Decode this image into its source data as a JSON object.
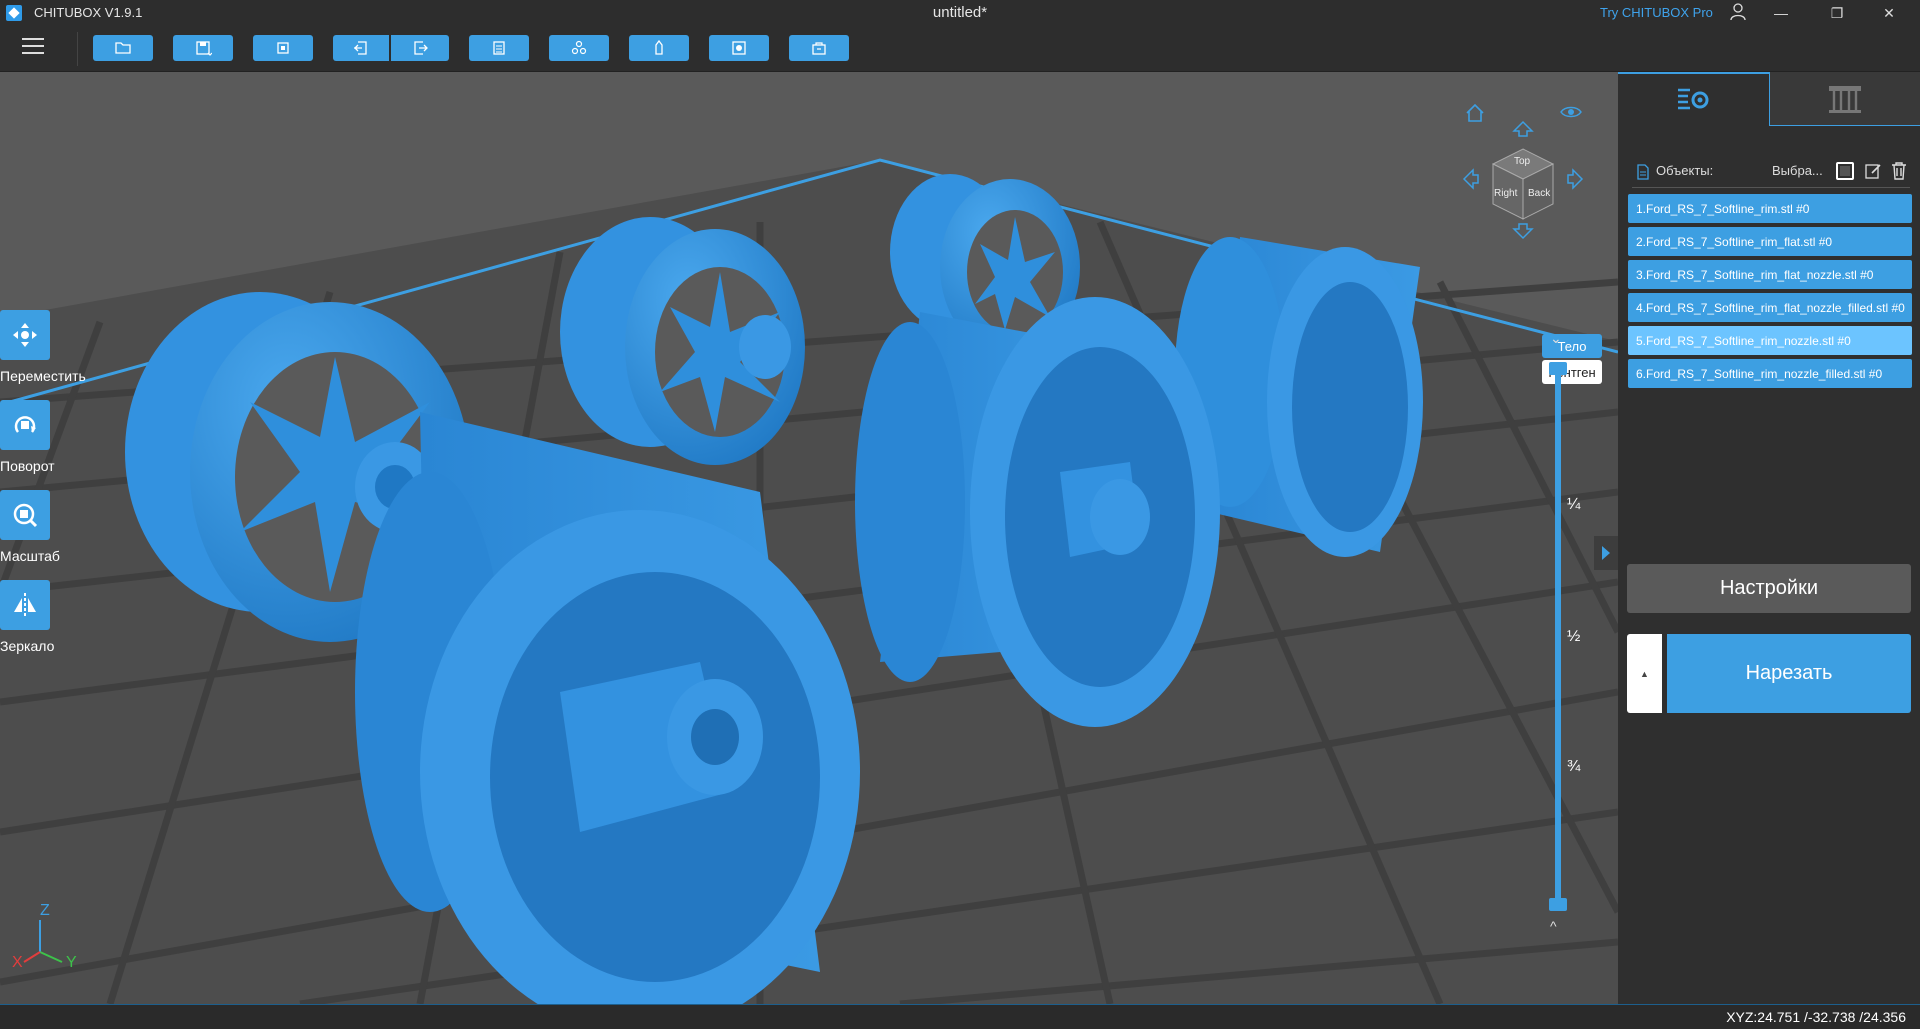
{
  "app": {
    "name": "CHITUBOX V1.9.1",
    "document_title": "untitled*",
    "try_pro": "Try CHITUBOX Pro"
  },
  "window": {
    "minimize": "—",
    "maximize": "❐",
    "close": "✕"
  },
  "toolbar": {
    "buttons": [
      "open-icon",
      "save-icon",
      "frame-icon",
      "import-icon",
      "export-icon",
      "layers-icon",
      "arrange-icon",
      "support-icon",
      "hollow-icon",
      "package-icon"
    ]
  },
  "tools": [
    {
      "id": "move",
      "label": "Переместить"
    },
    {
      "id": "rotate",
      "label": "Поворот"
    },
    {
      "id": "scale",
      "label": "Масштаб"
    },
    {
      "id": "mirror",
      "label": "Зеркало"
    }
  ],
  "nav_cube": {
    "top": "Top",
    "right": "Right",
    "back": "Back"
  },
  "view_modes": {
    "solid": "Тело",
    "xray": "Рентген",
    "active": "solid"
  },
  "layer_slider": {
    "marks": [
      "¼",
      "½",
      "¾"
    ],
    "upper_handle": 1.0,
    "lower_handle": 0.0
  },
  "axis": {
    "z": "Z",
    "x": "X",
    "y": "Y"
  },
  "panel": {
    "objects_label": "Объекты:",
    "select_label": "Выбра...",
    "objects": [
      "1.Ford_RS_7_Softline_rim.stl #0",
      "2.Ford_RS_7_Softline_rim_flat.stl #0",
      "3.Ford_RS_7_Softline_rim_flat_nozzle.stl #0",
      "4.Ford_RS_7_Softline_rim_flat_nozzle_filled.stl #0",
      "5.Ford_RS_7_Softline_rim_nozzle.stl #0",
      "6.Ford_RS_7_Softline_rim_nozzle_filled.stl #0"
    ],
    "selected_index": 4,
    "settings_label": "Настройки",
    "slice_label": "Нарезать",
    "slice_expand": "▲"
  },
  "status": {
    "coords": "XYZ:24.751 /-32.738 /24.356"
  },
  "colors": {
    "accent": "#3d9fe2",
    "model": "#2f8fdc",
    "viewport": "#5a5a5a"
  }
}
